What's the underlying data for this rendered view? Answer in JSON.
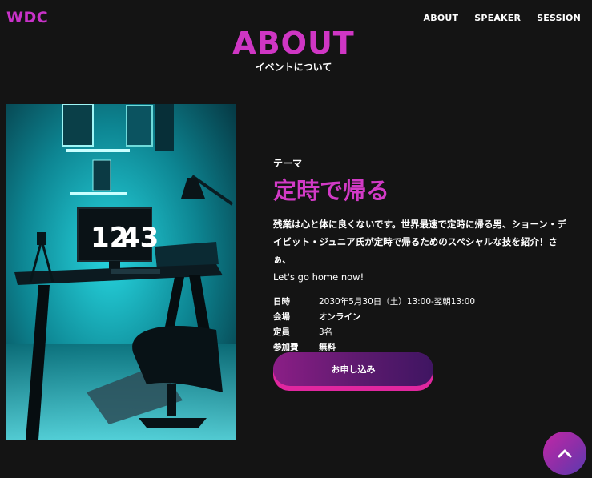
{
  "header": {
    "logo": "WDC",
    "nav": [
      {
        "label": "ABOUT"
      },
      {
        "label": "SPEAKER"
      },
      {
        "label": "SESSION"
      }
    ]
  },
  "section": {
    "title": "ABOUT",
    "subtitle": "イベントについて"
  },
  "photo": {
    "clock_hour": "12",
    "clock_minute": "43"
  },
  "event": {
    "theme_label": "テーマ",
    "theme_title": "定時で帰る",
    "description_ja": "残業は心と体に良くないです。世界最速で定時に帰る男、ショーン・デイビット・ジュニア氏が定時で帰るためのスペシャルな技を紹介！さぁ、",
    "description_en": "Let's go home now!",
    "details": [
      {
        "key": "日時",
        "value": "2030年5月30日（土）13:00-翌朝13:00"
      },
      {
        "key": "会場",
        "value": "オンライン"
      },
      {
        "key": "定員",
        "value": "3名"
      },
      {
        "key": "参加費",
        "value": "無料"
      }
    ],
    "apply_label": "お申し込み"
  },
  "colors": {
    "accent": "#d23ac6",
    "background": "#141414",
    "button_shadow": "#e0279f"
  },
  "icons": {
    "back_to_top": "chevron-up-icon"
  }
}
